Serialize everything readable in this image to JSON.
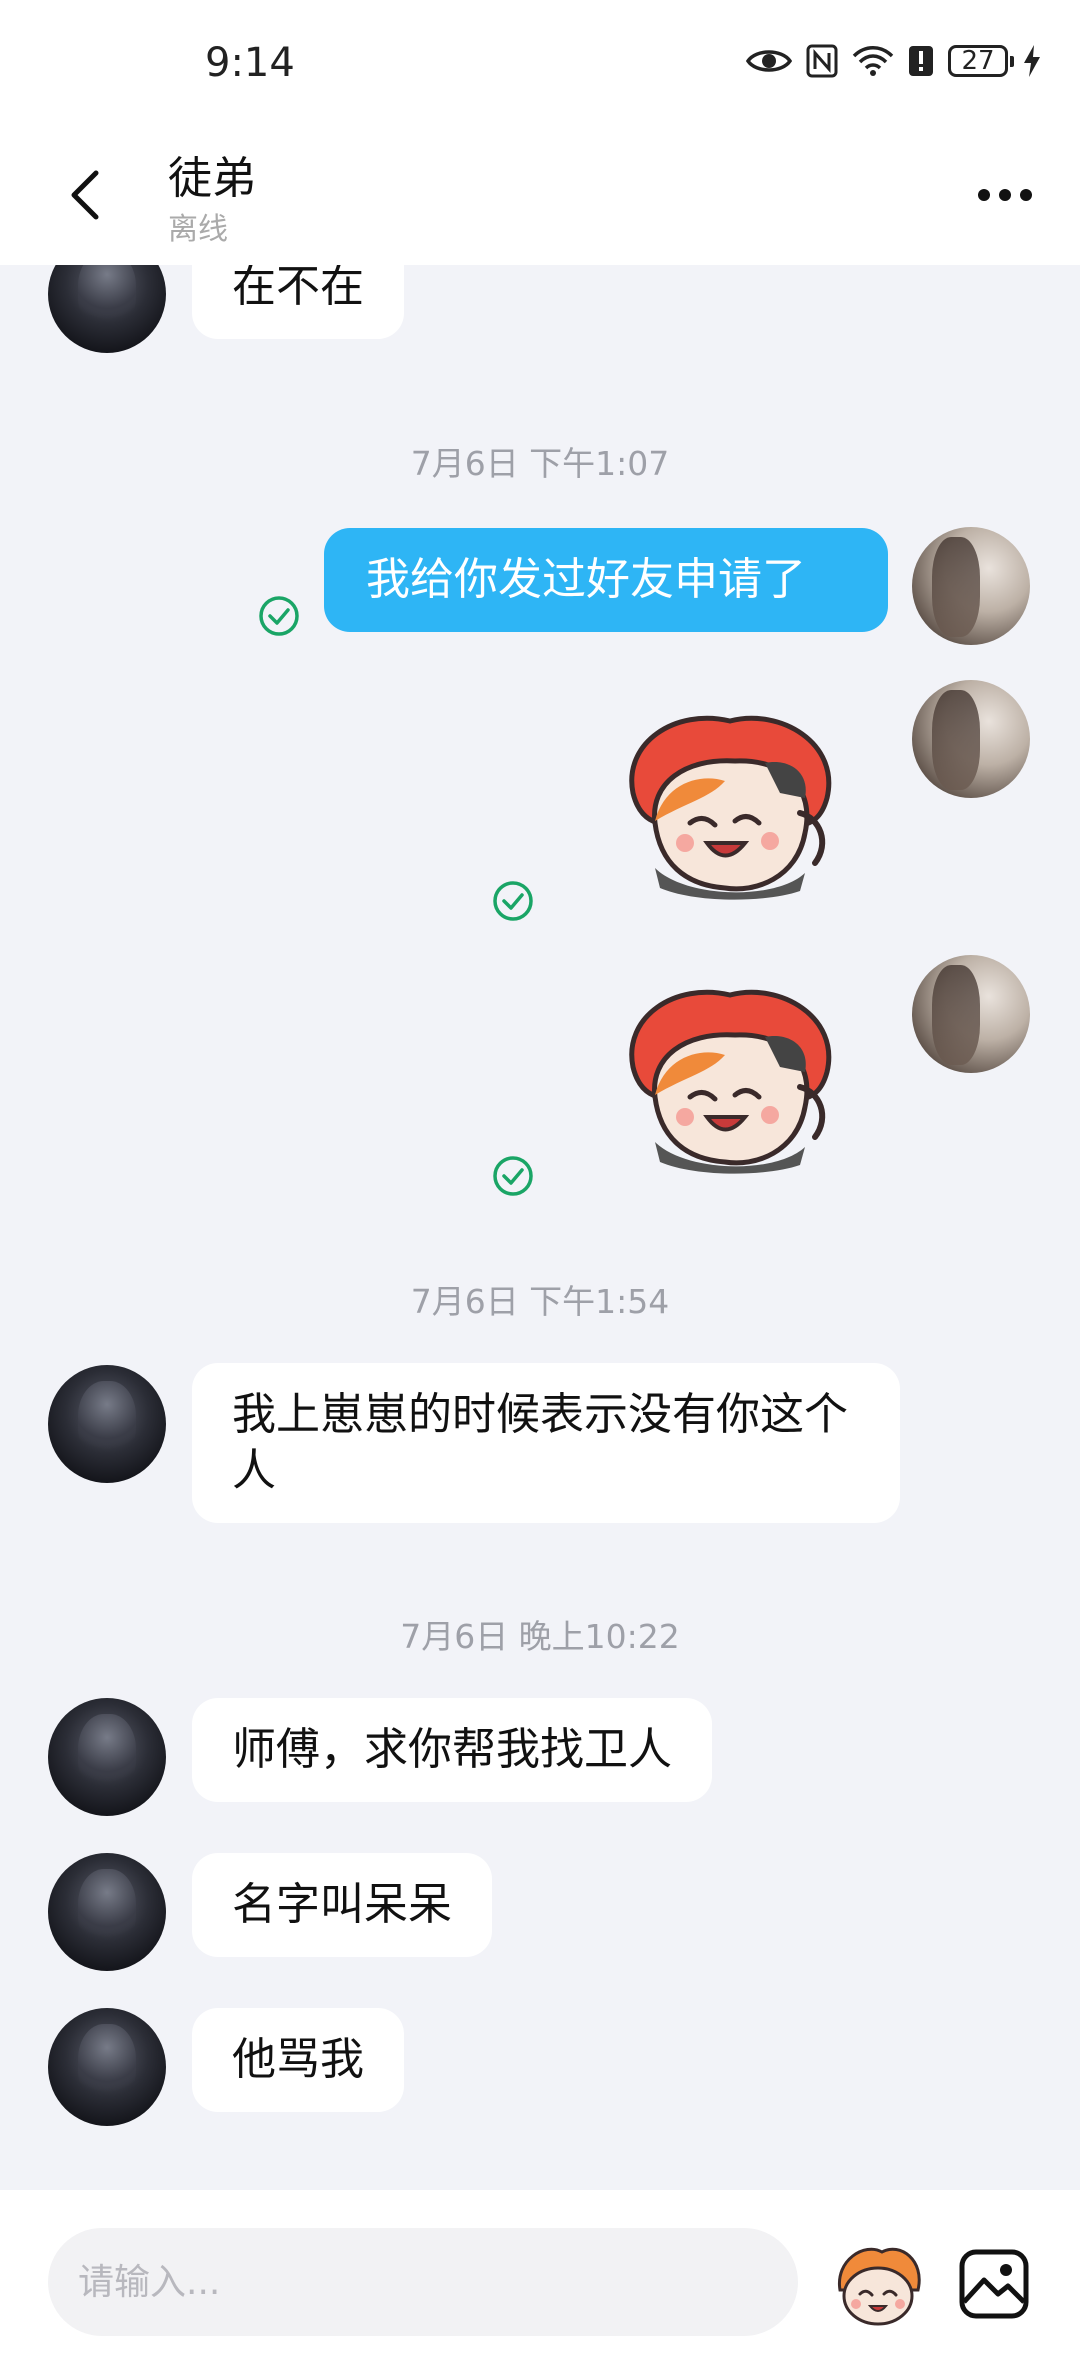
{
  "status_bar": {
    "time": "9:14",
    "battery": "27"
  },
  "header": {
    "title": "徒弟",
    "status": "离线"
  },
  "messages": [
    {
      "type": "in_text",
      "text": "在不在"
    },
    {
      "type": "timestamp",
      "text": "7月6日 下午1:07"
    },
    {
      "type": "out_text",
      "text": "我给你发过好友申请了",
      "delivery": "sent"
    },
    {
      "type": "out_sticker",
      "sticker": "sticker-icon",
      "delivery": "sent"
    },
    {
      "type": "out_sticker",
      "sticker": "sticker-icon",
      "delivery": "sent"
    },
    {
      "type": "timestamp",
      "text": "7月6日 下午1:54"
    },
    {
      "type": "in_text",
      "text": "我上崽崽的时候表示没有你这个人"
    },
    {
      "type": "timestamp",
      "text": "7月6日 晚上10:22"
    },
    {
      "type": "in_text",
      "text": "师傅，求你帮我找卫人"
    },
    {
      "type": "in_text",
      "text": "名字叫呆呆"
    },
    {
      "type": "in_text",
      "text": "他骂我"
    }
  ],
  "composer": {
    "placeholder": "请输入..."
  },
  "colors": {
    "accent": "#2eb5f5",
    "check": "#1aa566",
    "background": "#f2f3f8"
  }
}
